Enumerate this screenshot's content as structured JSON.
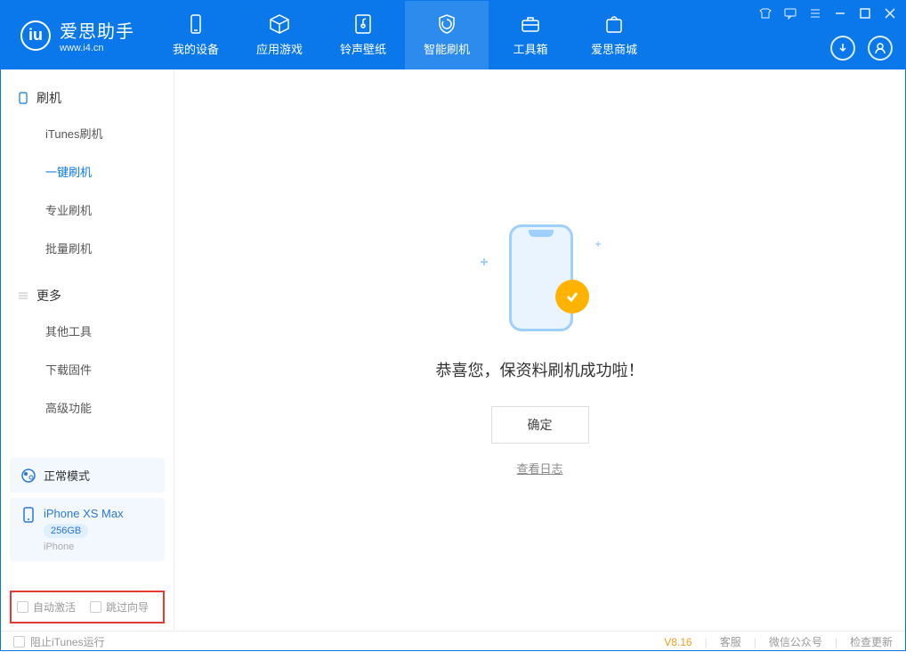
{
  "app": {
    "name": "爱思助手",
    "domain": "www.i4.cn"
  },
  "nav": {
    "device": "我的设备",
    "apps": "应用游戏",
    "ringtones": "铃声壁纸",
    "flash": "智能刷机",
    "toolbox": "工具箱",
    "store": "爱思商城"
  },
  "sidebar": {
    "group1": {
      "title": "刷机",
      "items": {
        "itunes": "iTunes刷机",
        "oneclick": "一键刷机",
        "pro": "专业刷机",
        "batch": "批量刷机"
      }
    },
    "group2": {
      "title": "更多",
      "items": {
        "other": "其他工具",
        "firmware": "下载固件",
        "advanced": "高级功能"
      }
    },
    "mode": "正常模式",
    "device": {
      "name": "iPhone XS Max",
      "capacity": "256GB",
      "type": "iPhone"
    },
    "checks": {
      "auto_activate": "自动激活",
      "skip_guide": "跳过向导"
    }
  },
  "main": {
    "success": "恭喜您，保资料刷机成功啦！",
    "ok": "确定",
    "view_log": "查看日志"
  },
  "status": {
    "block_itunes": "阻止iTunes运行",
    "version": "V8.16",
    "support": "客服",
    "wechat": "微信公众号",
    "update": "检查更新"
  }
}
